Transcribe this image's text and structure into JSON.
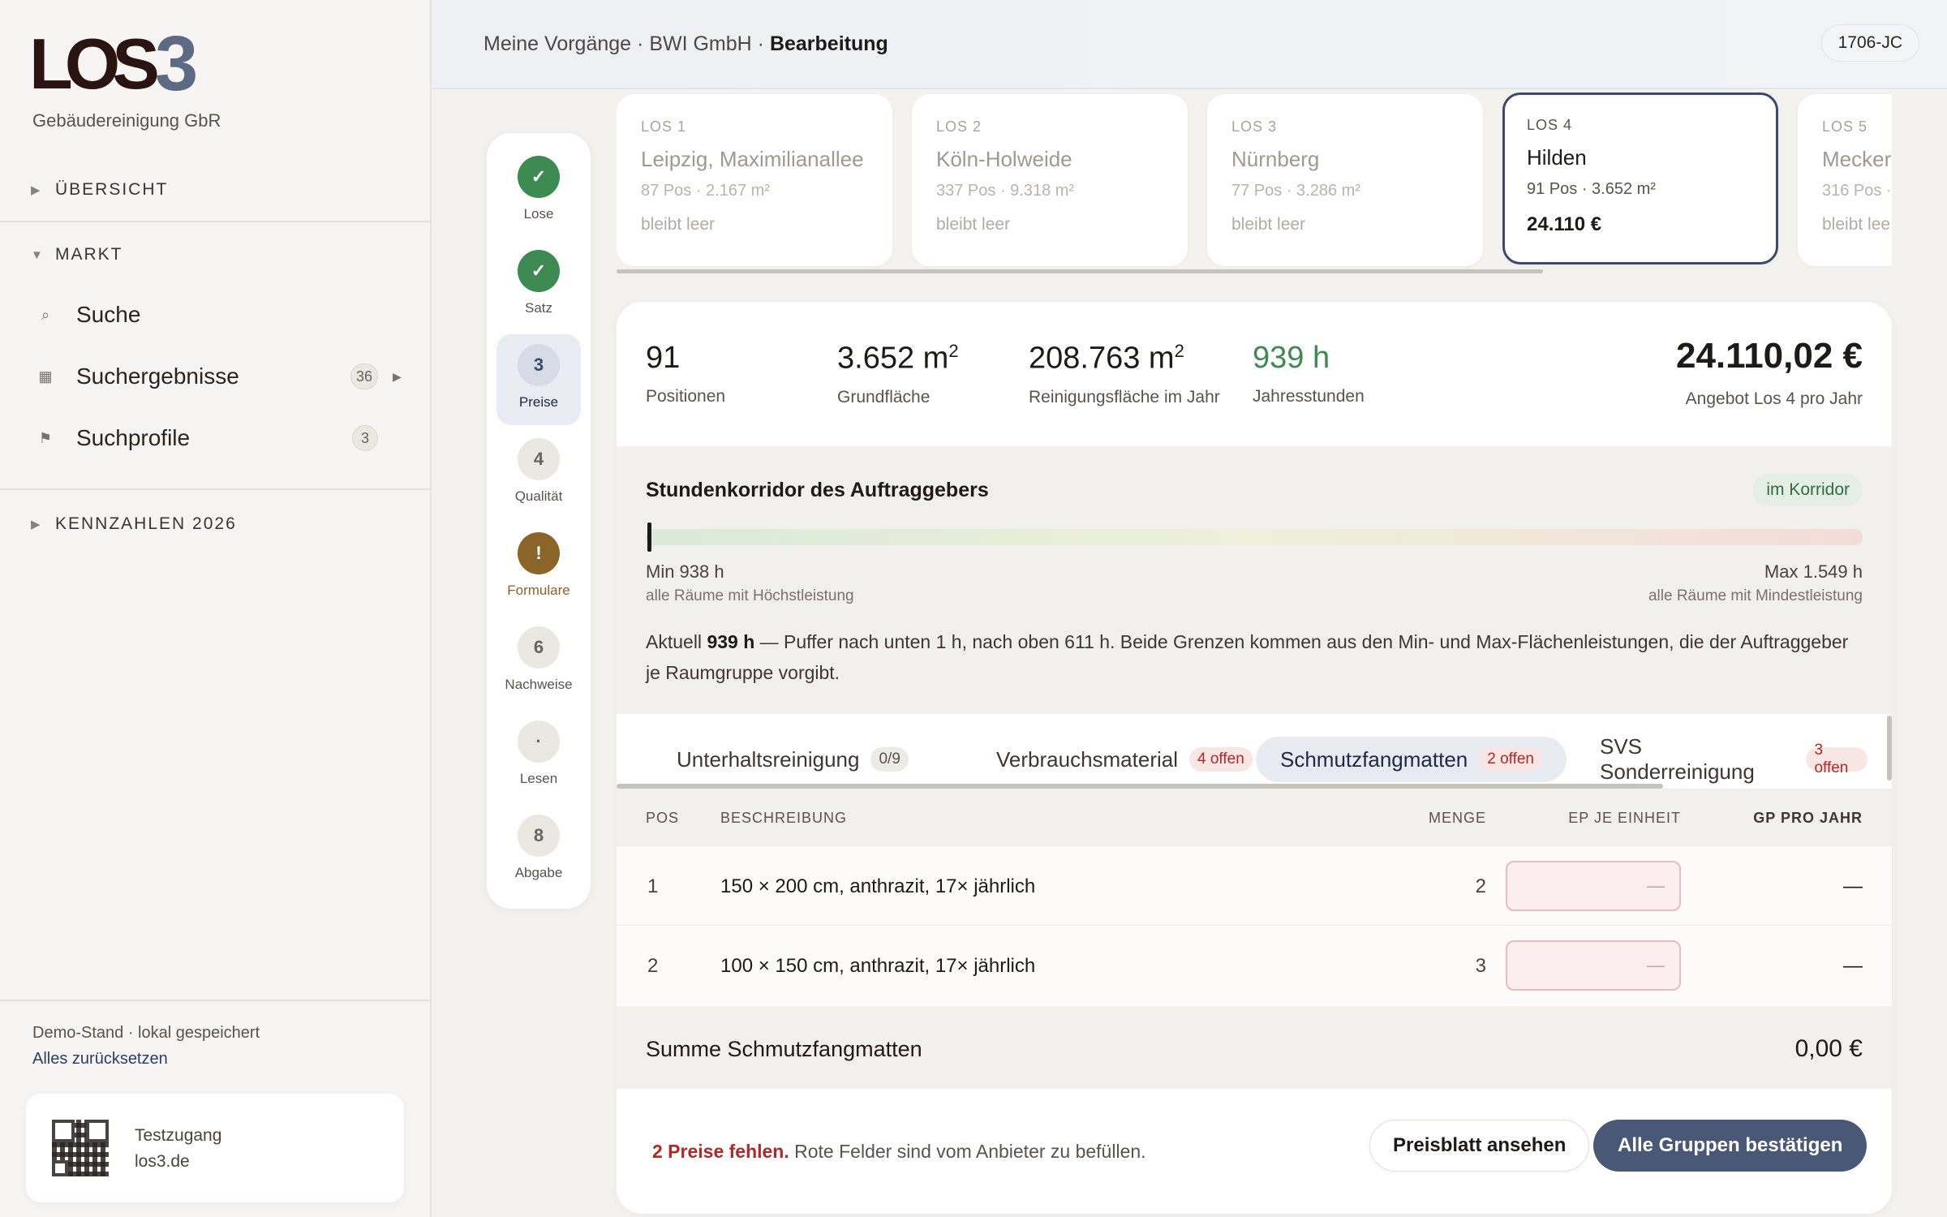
{
  "brand": {
    "logo_main": "LOS",
    "logo_num": "3",
    "company": "Gebäudereinigung GbR"
  },
  "sidebar": {
    "overview": "ÜBERSICHT",
    "market": "MARKT",
    "items": [
      {
        "label": "Suche",
        "icon": "search-icon"
      },
      {
        "label": "Suchergebnisse",
        "icon": "grid-icon",
        "count": "36"
      },
      {
        "label": "Suchprofile",
        "icon": "flag-icon",
        "count": "3"
      }
    ],
    "kpis": "KENNZAHLEN 2026",
    "demo": "Demo-Stand · lokal gespeichert",
    "reset": "Alles zurücksetzen",
    "qr_title": "Testzugang",
    "qr_url": "los3.de"
  },
  "header": {
    "crumb1": "Meine Vorgänge",
    "crumb2": "BWI GmbH",
    "crumb3": "Bearbeitung",
    "id": "1706-JC"
  },
  "steps": [
    {
      "num": "✓",
      "label": "Lose",
      "state": "done"
    },
    {
      "num": "✓",
      "label": "Satz",
      "state": "done"
    },
    {
      "num": "3",
      "label": "Preise",
      "state": "current"
    },
    {
      "num": "4",
      "label": "Qualität",
      "state": "todo"
    },
    {
      "num": "!",
      "label": "Formulare",
      "state": "warn"
    },
    {
      "num": "6",
      "label": "Nachweise",
      "state": "todo"
    },
    {
      "num": "·",
      "label": "Lesen",
      "state": "todo"
    },
    {
      "num": "8",
      "label": "Abgabe",
      "state": "todo"
    }
  ],
  "lots": [
    {
      "key": "LOS 1",
      "title": "Leipzig, Maximilianallee",
      "sub": "87 Pos · 2.167 m²",
      "foot": "bleibt leer"
    },
    {
      "key": "LOS 2",
      "title": "Köln-Holweide",
      "sub": "337 Pos · 9.318 m²",
      "foot": "bleibt leer"
    },
    {
      "key": "LOS 3",
      "title": "Nürnberg",
      "sub": "77 Pos · 3.286 m²",
      "foot": "bleibt leer"
    },
    {
      "key": "LOS 4",
      "title": "Hilden",
      "sub": "91 Pos · 3.652 m²",
      "foot": "24.110 €"
    },
    {
      "key": "LOS 5",
      "title": "Mecker",
      "sub": "316 Pos ·",
      "foot": "bleibt lee"
    }
  ],
  "stats": {
    "positions": "91",
    "positions_label": "Positionen",
    "area": "3.652 m",
    "area_label": "Grundfläche",
    "yearly_area": "208.763 m",
    "yearly_area_label": "Reinigungsfläche im Jahr",
    "hours": "939 h",
    "hours_label": "Jahresstunden",
    "total": "24.110,02 €",
    "total_label": "Angebot Los 4 pro Jahr",
    "superscript": "2"
  },
  "corridor": {
    "title": "Stundenkorridor des Auftraggebers",
    "status": "im Korridor",
    "min": "Min 938 h",
    "min_sub": "alle Räume mit Höchstleistung",
    "max": "Max 1.549 h",
    "max_sub": "alle Räume mit Mindestleistung",
    "current_fraction": 0.0016,
    "note_prefix": "Aktuell ",
    "note_value": "939 h",
    "note_text": " — Puffer nach unten 1 h, nach oben 611 h. Beide Grenzen kommen aus den Min- und Max-Flächenleistungen, die der Auftraggeber je Raumgruppe vorgibt."
  },
  "groups": [
    {
      "label": "Unterhaltsreinigung",
      "badge": "0/9"
    },
    {
      "label": "Verbrauchsmaterial",
      "badge": "4 offen"
    },
    {
      "label": "Schmutzfangmatten",
      "badge": "2 offen"
    },
    {
      "label": "SVS Sonderreinigung",
      "badge": "3 offen"
    }
  ],
  "table": {
    "headers": {
      "pos": "POS",
      "desc": "BESCHREIBUNG",
      "qty": "MENGE",
      "ep": "EP JE EINHEIT",
      "gp": "GP PRO JAHR"
    },
    "rows": [
      {
        "pos": "1",
        "desc": "150 × 200 cm, anthrazit, 17× jährlich",
        "qty": "2",
        "ep": "—",
        "gp": "—"
      },
      {
        "pos": "2",
        "desc": "100 × 150 cm, anthrazit, 17× jährlich",
        "qty": "3",
        "ep": "—",
        "gp": "—"
      }
    ],
    "sum_label": "Summe Schmutzfangmatten",
    "sum_value": "0,00 €"
  },
  "footer": {
    "missing_bold": "2 Preise fehlen.",
    "missing_text": " Rote Felder sind vom Anbieter zu befüllen.",
    "btn_view": "Preisblatt ansehen",
    "btn_confirm": "Alle Gruppen bestätigen"
  }
}
